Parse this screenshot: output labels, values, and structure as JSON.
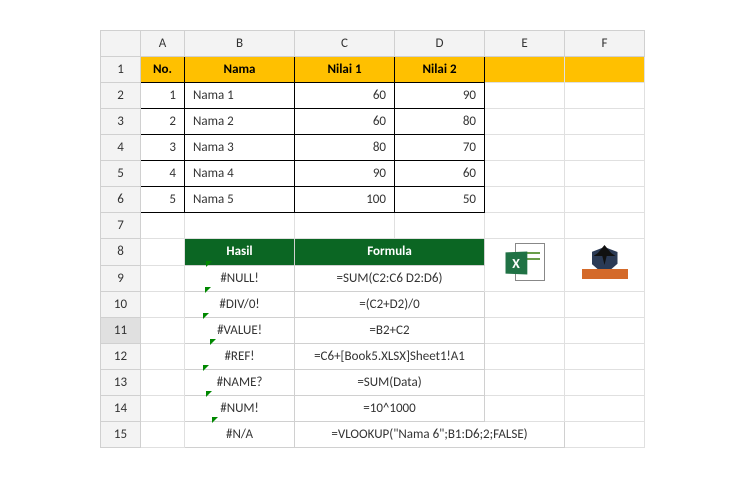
{
  "columns": [
    "A",
    "B",
    "C",
    "D",
    "E",
    "F"
  ],
  "rows": [
    "1",
    "2",
    "3",
    "4",
    "5",
    "6",
    "7",
    "8",
    "9",
    "10",
    "11",
    "12",
    "13",
    "14",
    "15"
  ],
  "header": {
    "no": "No.",
    "nama": "Nama",
    "nilai1": "Nilai 1",
    "nilai2": "Nilai 2"
  },
  "data": {
    "rows": [
      {
        "idx": "1",
        "nama": "Nama 1",
        "nilai1": "60",
        "nilai2": "90"
      },
      {
        "idx": "2",
        "nama": "Nama 2",
        "nilai1": "60",
        "nilai2": "80"
      },
      {
        "idx": "3",
        "nama": "Nama 3",
        "nilai1": "80",
        "nilai2": "70"
      },
      {
        "idx": "4",
        "nama": "Nama 4",
        "nilai1": "90",
        "nilai2": "60"
      },
      {
        "idx": "5",
        "nama": "Nama 5",
        "nilai1": "100",
        "nilai2": "50"
      }
    ]
  },
  "formula_header": {
    "hasil": "Hasil",
    "formula": "Formula"
  },
  "errors": {
    "rows": [
      {
        "hasil": "#NULL!",
        "formula": "=SUM(C2:C6 D2:D6)"
      },
      {
        "hasil": "#DIV/0!",
        "formula": "=(C2+D2)/0"
      },
      {
        "hasil": "#VALUE!",
        "formula": "=B2+C2"
      },
      {
        "hasil": "#REF!",
        "formula": "=C6+[Book5.XLSX]Sheet1!A1"
      },
      {
        "hasil": "#NAME?",
        "formula": "=SUM(Data)"
      },
      {
        "hasil": "#NUM!",
        "formula": "=10^1000"
      },
      {
        "hasil": "#N/A",
        "formula": "=VLOOKUP(\"Nama 6\";B1:D6;2;FALSE)"
      }
    ]
  },
  "icons": {
    "excel_x": "X"
  },
  "selected_row": "11"
}
